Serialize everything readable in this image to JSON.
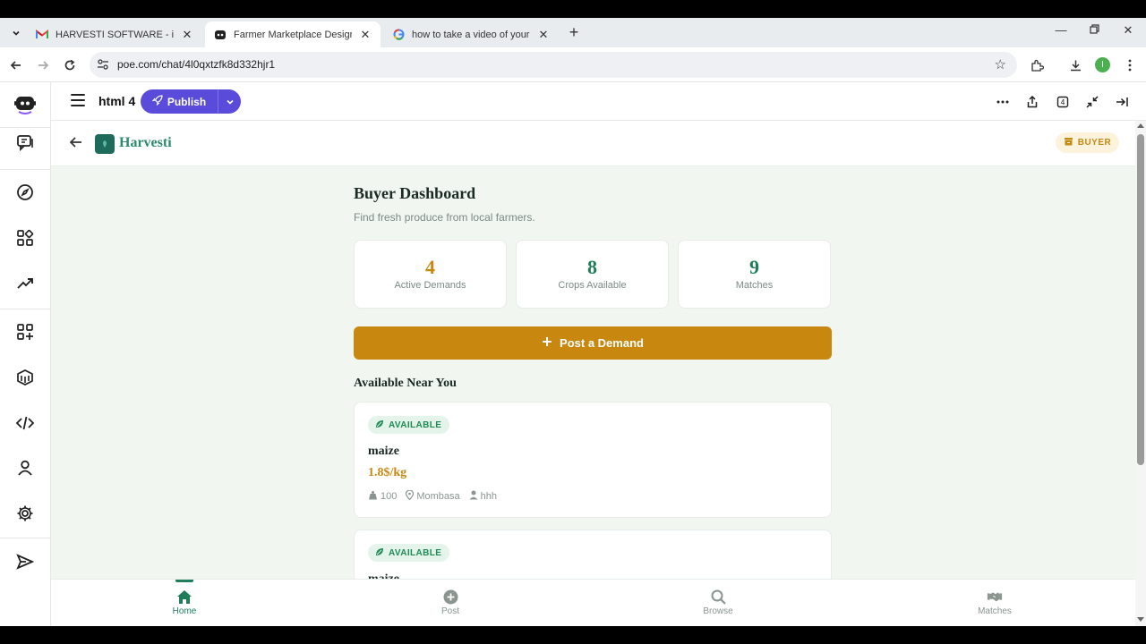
{
  "browser": {
    "tabs": [
      {
        "title": "HARVESTI SOFTWARE - ishimw",
        "icon": "gmail-icon"
      },
      {
        "title": "Farmer Marketplace Design - Pc",
        "icon": "poe-icon",
        "active": true
      },
      {
        "title": "how to take a video of your scr",
        "icon": "google-icon"
      }
    ],
    "url": "poe.com/chat/4l0qxtzfk8d332hjr1",
    "profile_initial": "I"
  },
  "poe": {
    "bot_name": "html 4",
    "publish_label": "Publish",
    "accent": "#5b4bdb"
  },
  "app": {
    "brand": "Harvesti",
    "role": "BUYER",
    "dashboard_title": "Buyer Dashboard",
    "dashboard_subtitle": "Find fresh produce from local farmers.",
    "stats": [
      {
        "value": "4",
        "label": "Active Demands",
        "color": "#c8870f"
      },
      {
        "value": "8",
        "label": "Crops Available",
        "color": "#1f7d5a"
      },
      {
        "value": "9",
        "label": "Matches",
        "color": "#1f7d5a"
      }
    ],
    "post_button": "Post a Demand",
    "section_title": "Available Near You",
    "listings": [
      {
        "status": "AVAILABLE",
        "name": "maize",
        "price": "1.8$/kg",
        "quantity": "100",
        "location": "Mombasa",
        "farmer": "hhh"
      },
      {
        "status": "AVAILABLE",
        "name": "maize",
        "price": "",
        "quantity": "",
        "location": "",
        "farmer": ""
      }
    ],
    "nav": [
      {
        "label": "Home",
        "icon": "home-icon",
        "active": true
      },
      {
        "label": "Post",
        "icon": "plus-circle-icon"
      },
      {
        "label": "Browse",
        "icon": "search-icon"
      },
      {
        "label": "Matches",
        "icon": "handshake-icon"
      }
    ],
    "colors": {
      "primary": "#1f7d5a",
      "gold": "#c8870f",
      "bg": "#f1f6f1"
    }
  }
}
